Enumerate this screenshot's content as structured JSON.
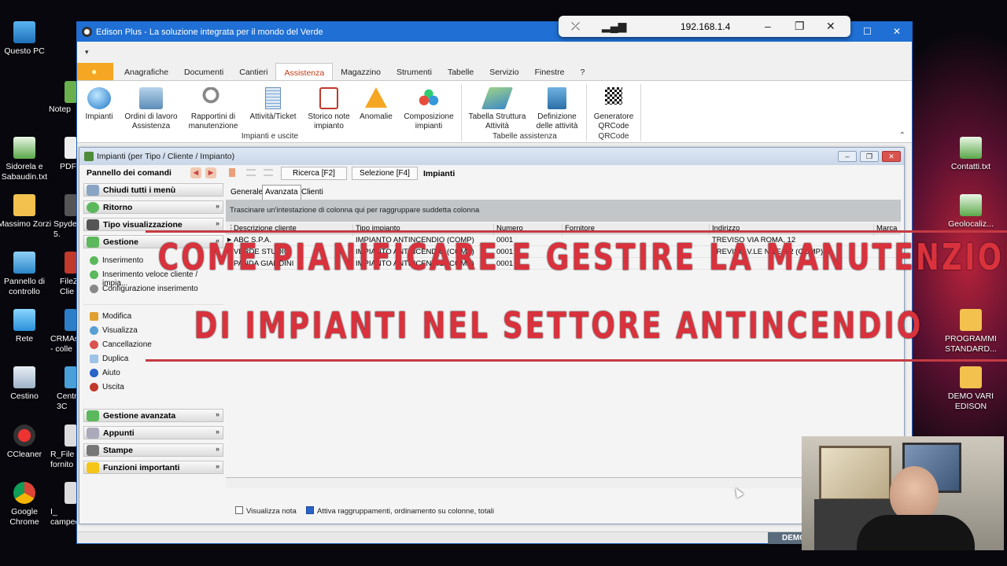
{
  "desktop_icons_left": [
    {
      "label": "Questo PC"
    },
    {
      "label": "Sidorela e Sabaudin.txt"
    },
    {
      "label": "Massimo Zorzi"
    },
    {
      "label": "Pannello di controllo"
    },
    {
      "label": "Rete"
    },
    {
      "label": "Cestino"
    },
    {
      "label": "CCleaner"
    },
    {
      "label": "Google Chrome"
    }
  ],
  "desktop_icons_left2": [
    {
      "label": "Notep"
    },
    {
      "label": "PDF"
    },
    {
      "label": "Spyde 5."
    },
    {
      "label": "FileZ Clie"
    },
    {
      "label": "CRMAs - colle"
    },
    {
      "label": "Centr 3C"
    },
    {
      "label": "R_File fornito"
    },
    {
      "label": "I_ campec"
    }
  ],
  "desktop_icons_right": [
    {
      "label": "Contatti.txt"
    },
    {
      "label": "Geolocaliz..."
    },
    {
      "label": "PROGRAMMI STANDARD..."
    },
    {
      "label": "DEMO VARI EDISON"
    }
  ],
  "remote_bar": {
    "ip": "192.168.1.4"
  },
  "window": {
    "title": "Edison Plus - La soluzione integrata per il mondo del Verde",
    "tabs": [
      "Anagrafiche",
      "Documenti",
      "Cantieri",
      "Assistenza",
      "Magazzino",
      "Strumenti",
      "Tabelle",
      "Servizio",
      "Finestre",
      "?"
    ],
    "active_tab": "Assistenza"
  },
  "ribbon": {
    "buttons": [
      {
        "label": "Impianti",
        "icon": "globe-icon"
      },
      {
        "label": "Ordini di lavoro Assistenza",
        "icon": "truck-icon"
      },
      {
        "label": "Rapportini di manutenzione",
        "icon": "wrench-person-icon"
      },
      {
        "label": "Attività/Ticket",
        "icon": "clipboard-icon"
      },
      {
        "label": "Storico note impianto",
        "icon": "history-note-icon"
      },
      {
        "label": "Anomalie",
        "icon": "warning-icon"
      },
      {
        "label": "Composizione impianti",
        "icon": "molecule-icon"
      },
      {
        "label": "Tabella Struttura Attività",
        "icon": "layers-icon"
      },
      {
        "label": "Definizione delle attività",
        "icon": "book-icon"
      },
      {
        "label": "Generatore QRCode",
        "icon": "qrcode-icon"
      }
    ],
    "groups": [
      "Impianti e uscite",
      "Tabelle assistenza",
      "QRCode"
    ]
  },
  "child": {
    "title": "Impianti (per Tipo / Cliente / Impianto)",
    "panel_title": "Pannello dei comandi",
    "sections": {
      "close_all": "Chiudi tutti i menù",
      "ritorno": "Ritorno",
      "tipo": "Tipo visualizzazione",
      "gestione": "Gestione",
      "gestione_avanzata": "Gestione avanzata",
      "appunti": "Appunti",
      "stampe": "Stampe",
      "funzioni": "Funzioni importanti"
    },
    "gestione_items": [
      "Inserimento",
      "Inserimento veloce cliente / impia...",
      "Configurazione inserimento"
    ],
    "gestione_items2": [
      "Modifica",
      "Visualizza",
      "Cancellazione",
      "Duplica",
      "Aiuto",
      "Uscita"
    ],
    "toolbar": {
      "ricerca": "Ricerca [F2]",
      "selezione": "Selezione [F4]",
      "title": "Impianti"
    },
    "subtabs": [
      "Generale",
      "Avanzata",
      "Clienti"
    ],
    "group_hint": "Trascinare un'intestazione di colonna qui per raggruppare suddetta colonna",
    "columns": [
      "Descrizione cliente",
      "Tipo impianto",
      "Numero",
      "Fornitore",
      "Indirizzo",
      "Marca"
    ],
    "rows": [
      [
        "ABC S.P.A.",
        "IMPIANTO ANTINCENDIO (COMP)",
        "0001",
        "",
        "TREVISO VIA ROMA, 12",
        ""
      ],
      [
        "VERDE STUDIO",
        "IMPIANTO ANTINCENDIO (COMP)",
        "0001",
        "",
        "TREVISO V.LE NILE, 12 (COMP)",
        ""
      ],
      [
        "PANDA GIARDINI",
        "IMPIANTO ANTINCENDIO (COMP)",
        "0001",
        "",
        "",
        ""
      ]
    ],
    "footer": {
      "note": "Visualizza nota",
      "groups": "Attiva raggruppamenti, ordinamento su colonne, totali"
    }
  },
  "overlay": {
    "line1": "COME PIANIFICARE E GESTIRE LA MANUTENZION",
    "line2": "DI IMPIANTI NEL SETTORE ANTINCENDIO"
  },
  "status": {
    "demo": "DEMO"
  }
}
